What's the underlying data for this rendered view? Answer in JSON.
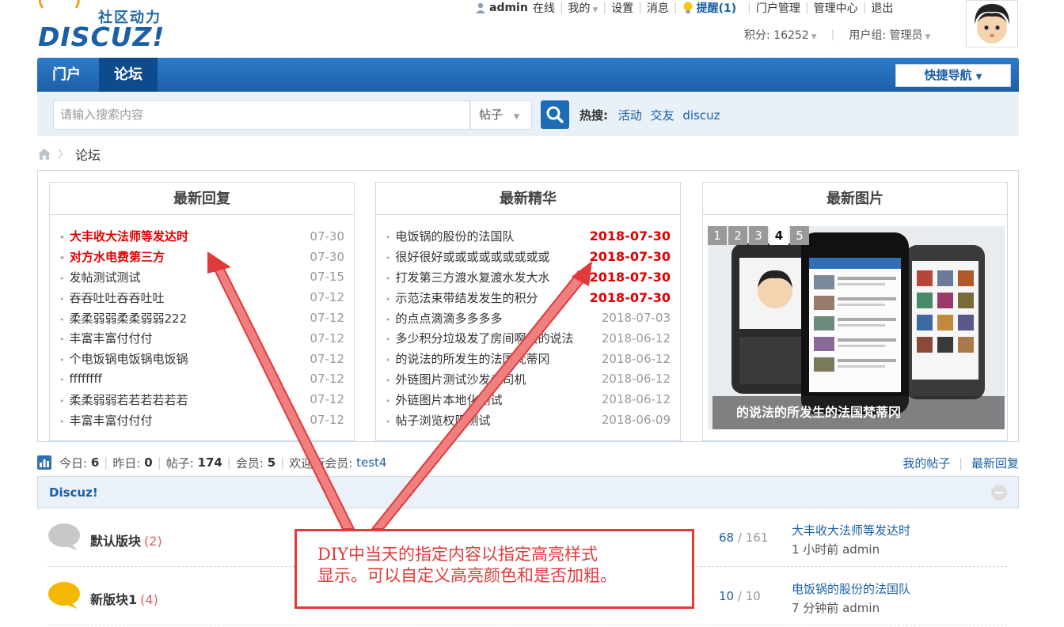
{
  "logo": {
    "slogan": "社区动力",
    "word": "DISCUZ!"
  },
  "userbar": {
    "username": "admin",
    "online": "在线",
    "mine": "我的",
    "settings": "设置",
    "messages": "消息",
    "remind": "提醒(1)",
    "portal_manage": "门户管理",
    "admin_center": "管理中心",
    "logout": "退出",
    "points": "积分: 16252",
    "usergroup": "用户组: 管理员"
  },
  "nav": {
    "tabs": [
      "门户",
      "论坛"
    ],
    "quick_nav": "快捷导航"
  },
  "search": {
    "placeholder": "请输入搜索内容",
    "type": "帖子",
    "hot_label": "热搜:",
    "hot": [
      "活动",
      "交友",
      "discuz"
    ]
  },
  "breadcrumb": {
    "current": "论坛"
  },
  "panels": {
    "latest_reply": {
      "title": "最新回复",
      "items": [
        {
          "title": "大丰收大法师等发达时",
          "date": "07-30"
        },
        {
          "title": "对方水电费第三方",
          "date": "07-30"
        },
        {
          "title": "发帖测试测试",
          "date": "07-15"
        },
        {
          "title": "吞吞吐吐吞吞吐吐",
          "date": "07-12"
        },
        {
          "title": "柔柔弱弱柔柔弱弱222",
          "date": "07-12"
        },
        {
          "title": "丰富丰富付付付",
          "date": "07-12"
        },
        {
          "title": "个电饭锅电饭锅电饭锅",
          "date": "07-12"
        },
        {
          "title": "ffffffff",
          "date": "07-12"
        },
        {
          "title": "柔柔弱弱若若若若若若",
          "date": "07-12"
        },
        {
          "title": "丰富丰富付付付",
          "date": "07-12"
        }
      ]
    },
    "latest_digest": {
      "title": "最新精华",
      "items": [
        {
          "title": "电饭锅的股份的法国队",
          "date": "2018-07-30"
        },
        {
          "title": "很好很好或或或或或或或或或",
          "date": "2018-07-30"
        },
        {
          "title": "打发第三方渡水复渡水发大水",
          "date": "2018-07-30"
        },
        {
          "title": "示范法束带结发发生的积分",
          "date": "2018-07-30"
        },
        {
          "title": "的点点滴滴多多多多",
          "date": "2018-07-03"
        },
        {
          "title": "多少积分垃圾发了房间啊发的说法",
          "date": "2018-06-12"
        },
        {
          "title": "的说法的所发生的法国梵蒂冈",
          "date": "2018-06-12"
        },
        {
          "title": "外链图片测试沙发老司机",
          "date": "2018-06-12"
        },
        {
          "title": "外链图片本地化测试",
          "date": "2018-06-12"
        },
        {
          "title": "帖子浏览权限测试",
          "date": "2018-06-09"
        }
      ]
    },
    "latest_pics": {
      "title": "最新图片",
      "pages": [
        "1",
        "2",
        "3",
        "4",
        "5"
      ],
      "active_page": "4",
      "caption": "的说法的所发生的法国梵蒂冈"
    }
  },
  "stats": {
    "today_label": "今日:",
    "today": "6",
    "yesterday_label": "昨日:",
    "yesterday": "0",
    "posts_label": "帖子:",
    "posts": "174",
    "members_label": "会员:",
    "members": "5",
    "welcome_label": "欢迎新会员:",
    "new_member": "test4",
    "my_posts": "我的帖子",
    "latest_replies": "最新回复"
  },
  "forum": {
    "group_title": "Discuz!",
    "rows": [
      {
        "name": "默认版块",
        "count": "(2)",
        "threads": "68",
        "posts": "161",
        "last_title": "大丰收大法师等发达时",
        "last_meta": "1 小时前 admin"
      },
      {
        "name": "新版块1",
        "count": "(4)",
        "threads": "10",
        "posts": "10",
        "last_title": "电饭锅的股份的法国队",
        "last_meta": "7 分钟前 admin"
      }
    ]
  },
  "annotation": {
    "line1": "DIY中当天的指定内容以指定高亮样式",
    "line2": "显示。可以自定义高亮颜色和是否加粗。"
  },
  "colors": {
    "brand": "#1b5fa8",
    "highlight": "#e00000",
    "annotation": "#e03a3a"
  }
}
